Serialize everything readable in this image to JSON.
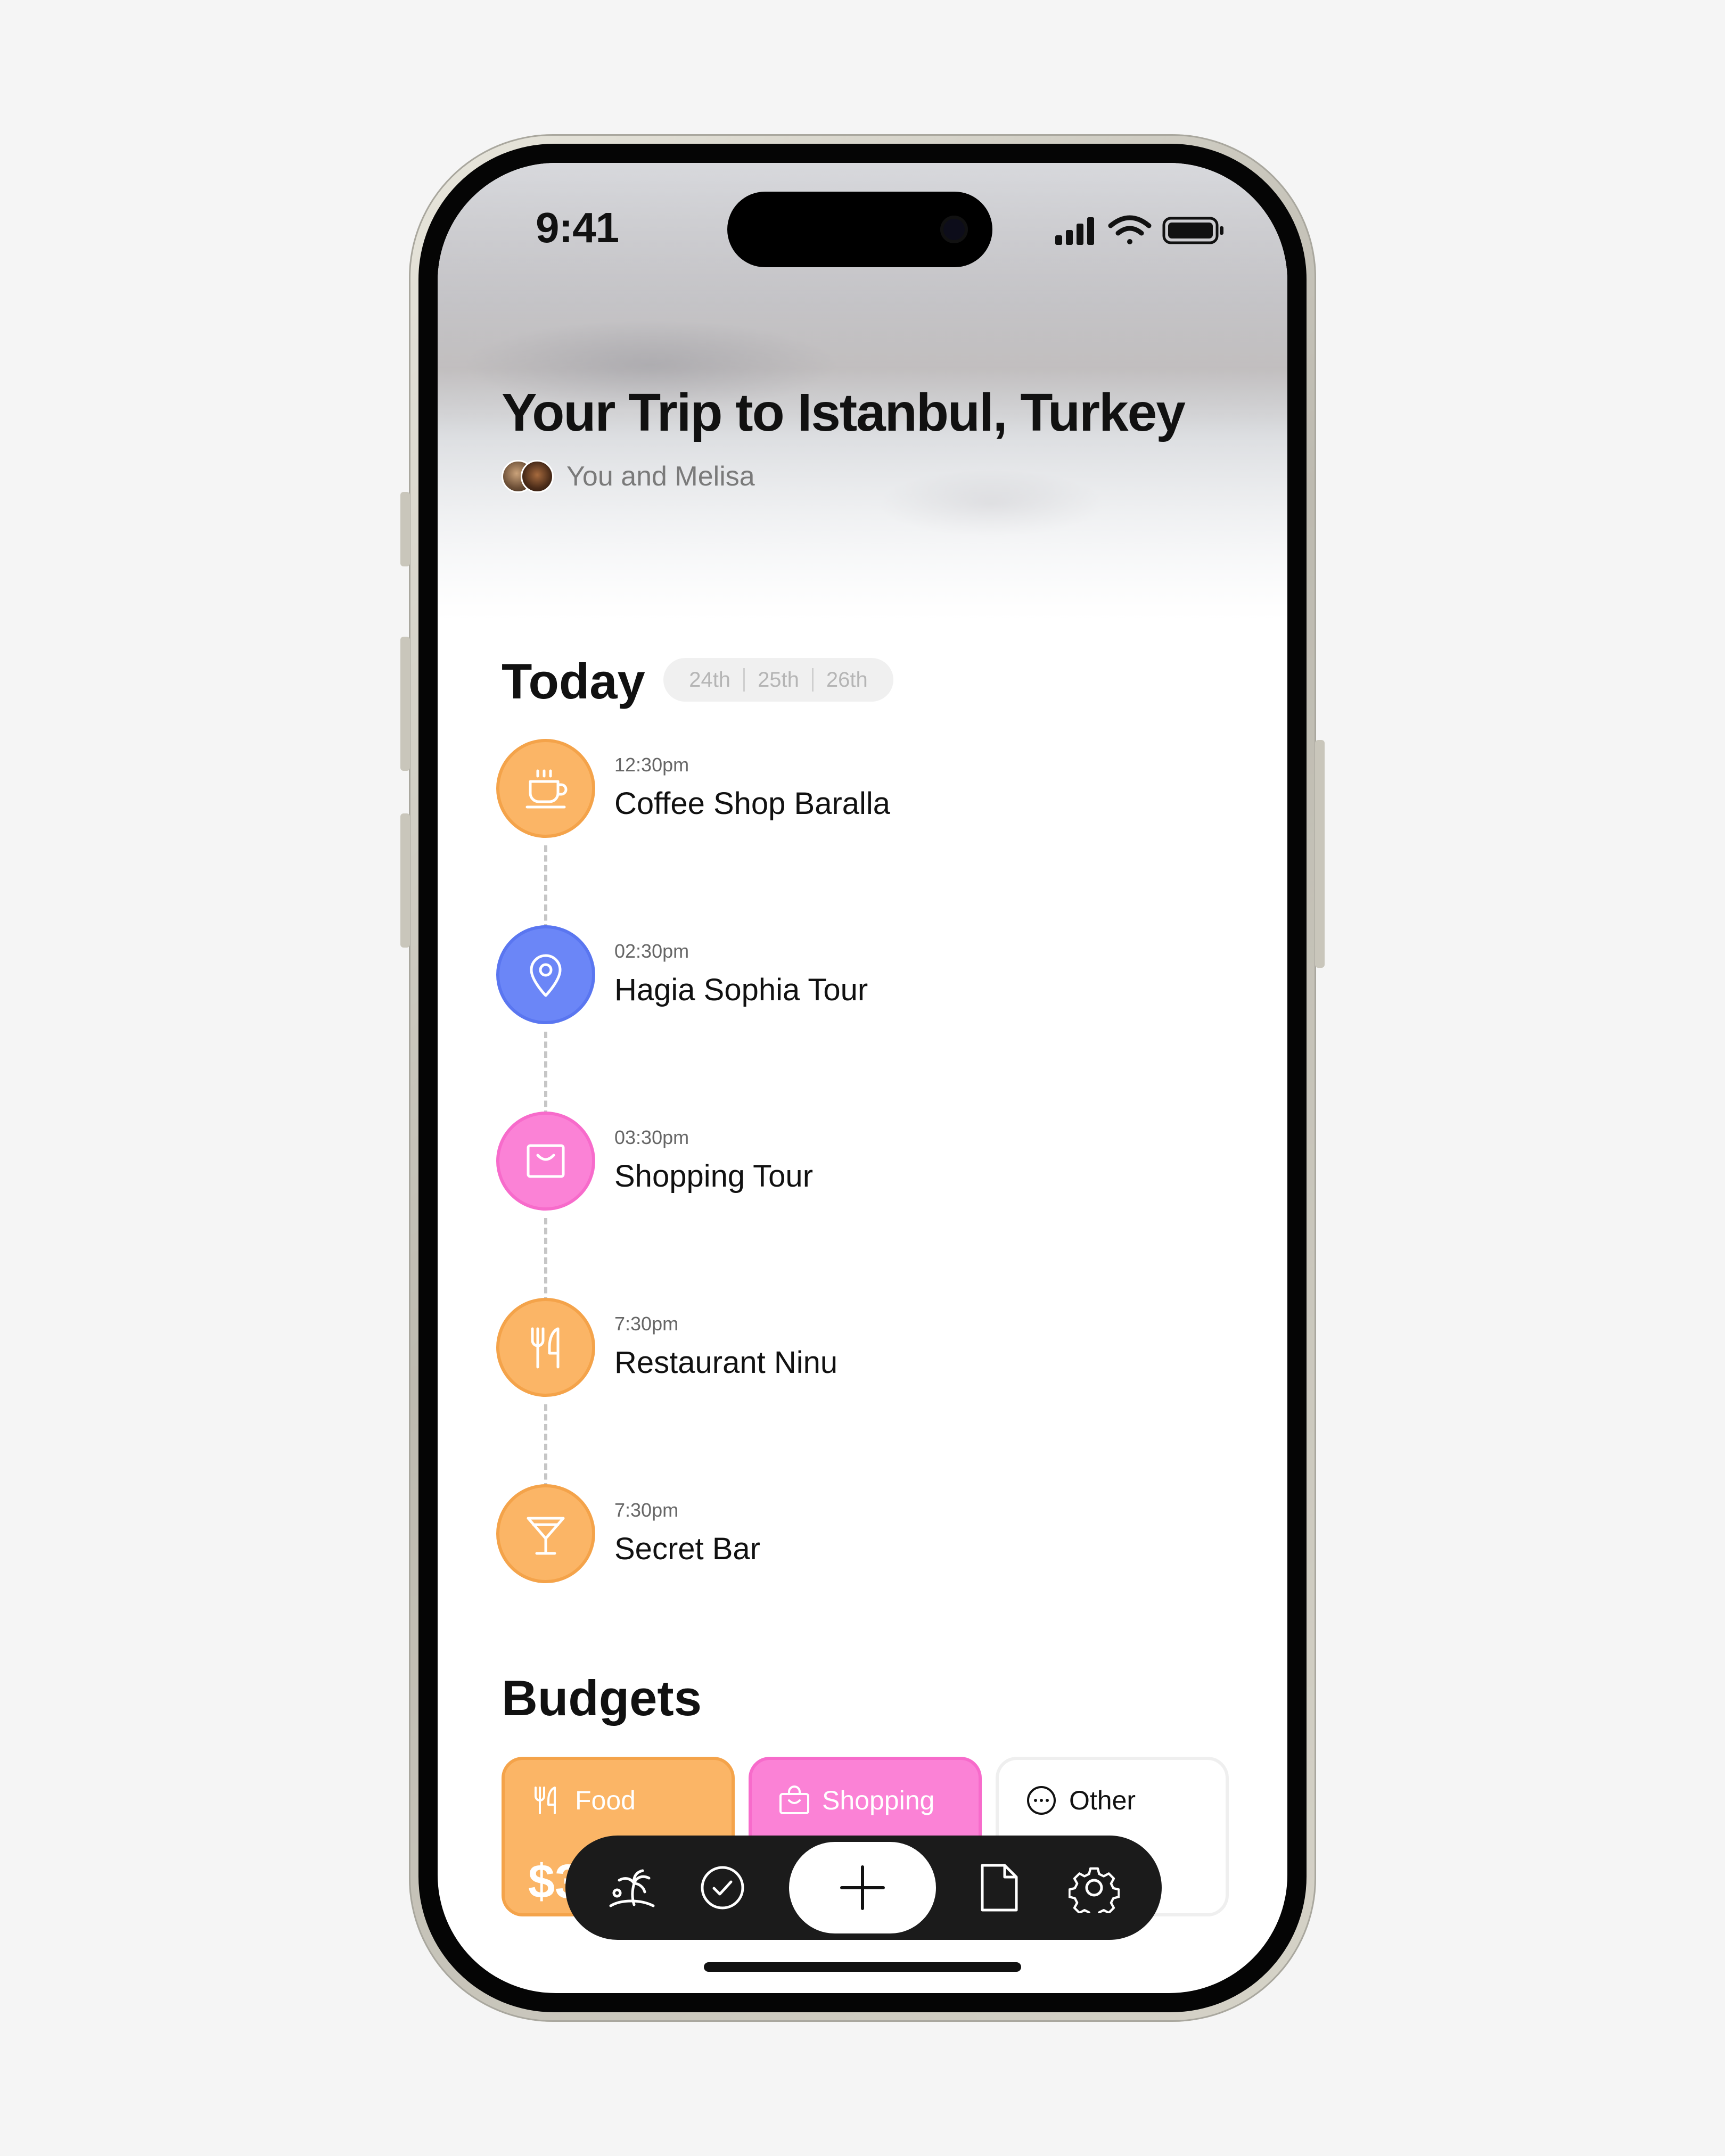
{
  "status_bar": {
    "time": "9:41"
  },
  "trip": {
    "title": "Your Trip to Istanbul, Turkey",
    "companions": "You and Melisa"
  },
  "schedule": {
    "heading": "Today",
    "dates": [
      "24th",
      "25th",
      "26th"
    ],
    "items": [
      {
        "time": "12:30pm",
        "name": "Coffee Shop Baralla",
        "icon": "coffee-cup-icon",
        "color": "#fbb566"
      },
      {
        "time": "02:30pm",
        "name": "Hagia Sophia Tour",
        "icon": "map-pin-icon",
        "color": "#6b86f7"
      },
      {
        "time": "03:30pm",
        "name": "Shopping Tour",
        "icon": "shopping-bag-icon",
        "color": "#fb82d6"
      },
      {
        "time": "7:30pm",
        "name": "Restaurant Ninu",
        "icon": "fork-knife-icon",
        "color": "#fbb566"
      },
      {
        "time": "7:30pm",
        "name": "Secret Bar",
        "icon": "cocktail-icon",
        "color": "#fbb566"
      }
    ]
  },
  "budgets": {
    "heading": "Budgets",
    "cards": [
      {
        "label": "Food",
        "amount": "$3",
        "icon": "fork-knife-icon",
        "color": "#fbb566"
      },
      {
        "label": "Shopping",
        "icon": "shopping-bag-icon",
        "color": "#fb82d6"
      },
      {
        "label": "Other",
        "icon": "more-dots-icon",
        "color": "#ffffff"
      }
    ]
  },
  "tab_bar": {
    "tabs": [
      "island-icon",
      "check-circle-icon",
      "plus-icon",
      "document-icon",
      "gear-icon"
    ]
  }
}
